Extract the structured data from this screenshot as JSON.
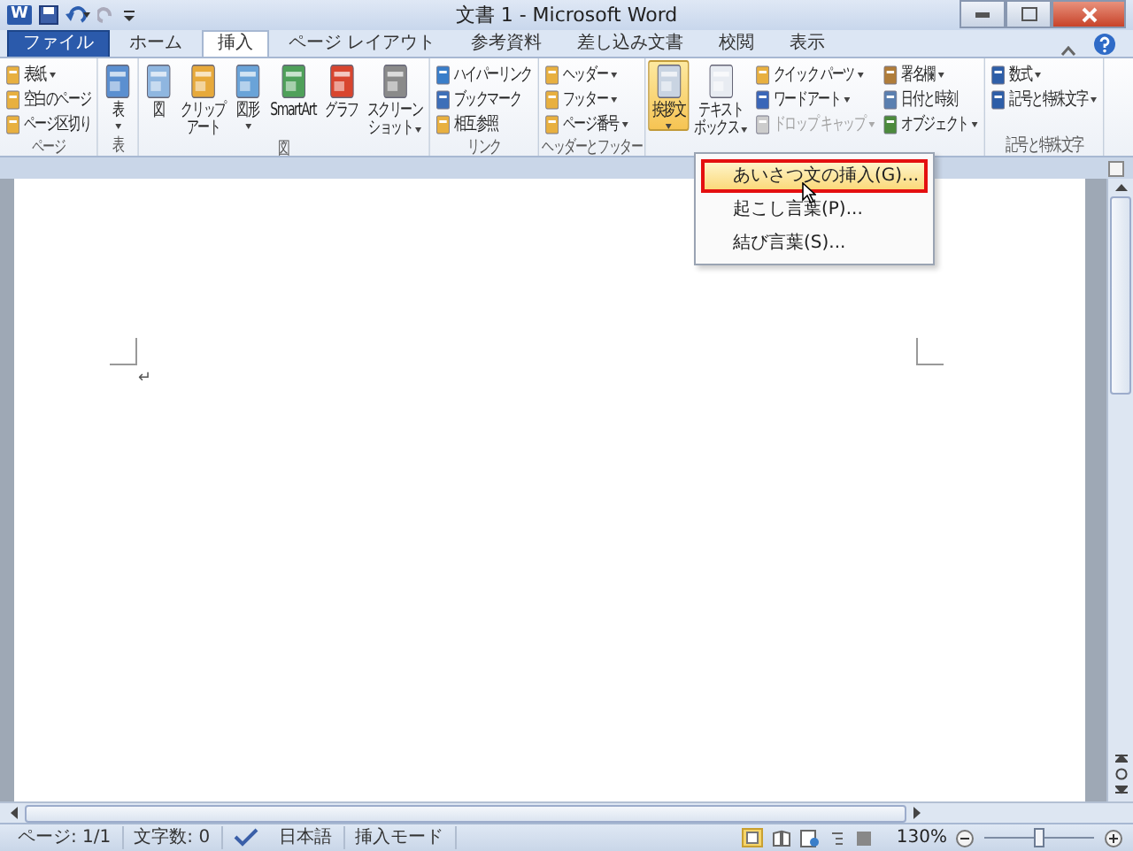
{
  "window": {
    "app_logo": "W",
    "title": "文書 1 - Microsoft Word"
  },
  "tabs": [
    {
      "label": "ファイル",
      "kind": "file",
      "selected": false
    },
    {
      "label": "ホーム",
      "kind": "tab",
      "selected": false
    },
    {
      "label": "挿入",
      "kind": "tab",
      "selected": true
    },
    {
      "label": "ページ レイアウト",
      "kind": "tab",
      "selected": false
    },
    {
      "label": "参考資料",
      "kind": "tab",
      "selected": false
    },
    {
      "label": "差し込み文書",
      "kind": "tab",
      "selected": false
    },
    {
      "label": "校閲",
      "kind": "tab",
      "selected": false
    },
    {
      "label": "表示",
      "kind": "tab",
      "selected": false
    }
  ],
  "ribbon_groups": [
    {
      "label": "ページ",
      "columns": [
        {
          "kind": "stack",
          "items": [
            {
              "label": "表紙",
              "dropdown": true,
              "disabled": false
            },
            {
              "label": "空白のページ",
              "dropdown": false,
              "disabled": false
            },
            {
              "label": "ページ区切り",
              "dropdown": false,
              "disabled": false
            }
          ]
        }
      ]
    },
    {
      "label": "表",
      "columns": [
        {
          "kind": "large",
          "lines": [
            "表"
          ],
          "dropdown": true,
          "pressed": false
        }
      ]
    },
    {
      "label": "図",
      "columns": [
        {
          "kind": "large",
          "lines": [
            "図"
          ],
          "dropdown": false,
          "pressed": false
        },
        {
          "kind": "large",
          "lines": [
            "クリップ",
            "アート"
          ],
          "dropdown": false,
          "pressed": false
        },
        {
          "kind": "large",
          "lines": [
            "図形"
          ],
          "dropdown": true,
          "pressed": false
        },
        {
          "kind": "large",
          "lines": [
            "SmartArt"
          ],
          "dropdown": false,
          "pressed": false
        },
        {
          "kind": "large",
          "lines": [
            "グラフ"
          ],
          "dropdown": false,
          "pressed": false
        },
        {
          "kind": "large",
          "lines": [
            "スクリーン",
            "ショット"
          ],
          "dropdown": true,
          "pressed": false
        }
      ]
    },
    {
      "label": "リンク",
      "columns": [
        {
          "kind": "stack",
          "items": [
            {
              "label": "ハイパーリンク",
              "dropdown": false,
              "disabled": false
            },
            {
              "label": "ブックマーク",
              "dropdown": false,
              "disabled": false
            },
            {
              "label": "相互参照",
              "dropdown": false,
              "disabled": false
            }
          ]
        }
      ]
    },
    {
      "label": "ヘッダーとフッター",
      "columns": [
        {
          "kind": "stack",
          "items": [
            {
              "label": "ヘッダー",
              "dropdown": true,
              "disabled": false
            },
            {
              "label": "フッター",
              "dropdown": true,
              "disabled": false
            },
            {
              "label": "ページ番号",
              "dropdown": true,
              "disabled": false
            }
          ]
        }
      ]
    },
    {
      "columns": [
        {
          "kind": "large",
          "lines": [
            "挨拶文"
          ],
          "dropdown": true,
          "pressed": true
        },
        {
          "kind": "large",
          "lines": [
            "テキスト",
            "ボックス"
          ],
          "dropdown": true,
          "pressed": false
        },
        {
          "kind": "stack",
          "items": [
            {
              "label": "クイック パーツ",
              "dropdown": true,
              "disabled": false
            },
            {
              "label": "ワードアート",
              "dropdown": true,
              "disabled": false
            },
            {
              "label": "ドロップ キャップ",
              "dropdown": true,
              "disabled": true
            }
          ]
        },
        {
          "kind": "stack",
          "items": [
            {
              "label": "署名欄",
              "dropdown": true,
              "disabled": false
            },
            {
              "label": "日付と時刻",
              "dropdown": false,
              "disabled": false
            },
            {
              "label": "オブジェクト",
              "dropdown": true,
              "disabled": false
            }
          ]
        }
      ]
    },
    {
      "label": "記号と特殊文字",
      "columns": [
        {
          "kind": "stack",
          "items": [
            {
              "label": "数式",
              "dropdown": true,
              "disabled": false
            },
            {
              "label": "記号と特殊文字",
              "dropdown": true,
              "disabled": false
            }
          ]
        }
      ]
    }
  ],
  "dropdown_menu": [
    {
      "label": "あいさつ文の挿入(G)...",
      "highlighted": true
    },
    {
      "label": "起こし言葉(P)...",
      "highlighted": false
    },
    {
      "label": "結び言葉(S)...",
      "highlighted": false
    }
  ],
  "document": {
    "paragraph_mark": "↵"
  },
  "status_bar": {
    "left": [
      {
        "kind": "text",
        "label": "ページ: 1/1"
      },
      {
        "kind": "text",
        "label": "文字数: 0"
      },
      {
        "kind": "icon"
      },
      {
        "kind": "text",
        "label": "日本語"
      },
      {
        "kind": "text",
        "label": "挿入モード"
      }
    ],
    "zoom": "130%",
    "zoom_slider": {
      "level": 0.5
    }
  }
}
